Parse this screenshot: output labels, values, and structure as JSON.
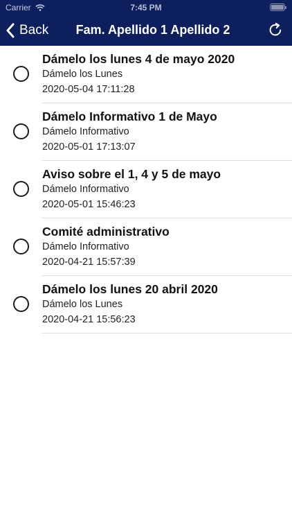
{
  "status_bar": {
    "carrier": "Carrier",
    "time": "7:45 PM",
    "wifi_icon": "wifi-icon",
    "battery_icon": "battery-icon"
  },
  "nav": {
    "back_label": "Back",
    "back_icon": "chevron-left-icon",
    "title": "Fam. Apellido 1 Apellido 2",
    "refresh_icon": "refresh-icon"
  },
  "messages": [
    {
      "title": "Dámelo los lunes 4 de mayo 2020",
      "category": "Dámelo los Lunes",
      "datetime": "2020-05-04 17:11:28"
    },
    {
      "title": "Dámelo Informativo 1 de Mayo",
      "category": "Dámelo Informativo",
      "datetime": "2020-05-01 17:13:07"
    },
    {
      "title": "Aviso sobre el 1, 4 y 5 de mayo",
      "category": "Dámelo Informativo",
      "datetime": "2020-05-01 15:46:23"
    },
    {
      "title": "Comité administrativo",
      "category": "Dámelo Informativo",
      "datetime": "2020-04-21 15:57:39"
    },
    {
      "title": "Dámelo los lunes 20 abril 2020",
      "category": "Dámelo los Lunes",
      "datetime": "2020-04-21 15:56:23"
    }
  ],
  "colors": {
    "navbar": "#0d1f5c",
    "text": "#111111",
    "separator": "#dcdcdc"
  }
}
